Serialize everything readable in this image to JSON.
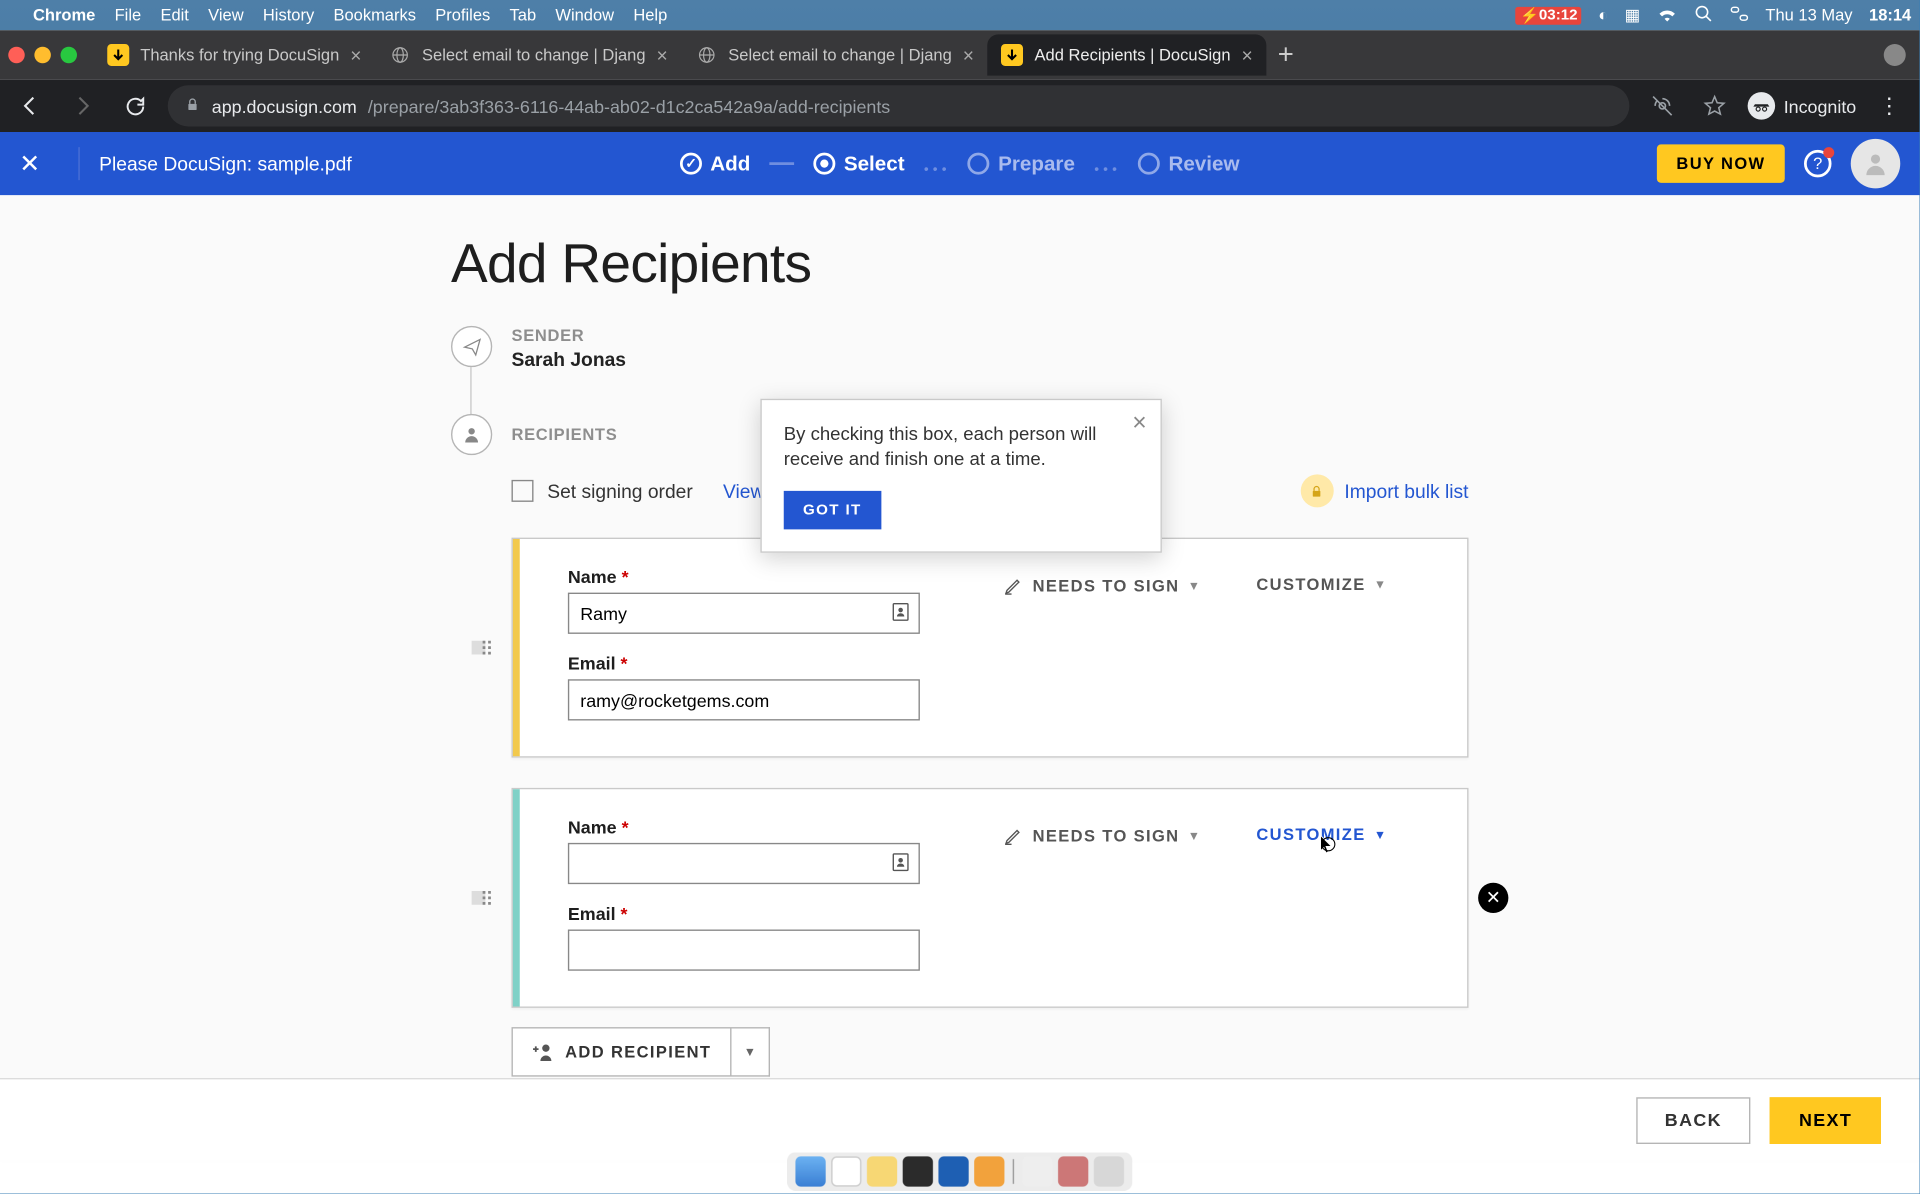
{
  "menubar": {
    "app": "Chrome",
    "items": [
      "File",
      "Edit",
      "View",
      "History",
      "Bookmarks",
      "Profiles",
      "Tab",
      "Window",
      "Help"
    ],
    "battery": "03:12",
    "date": "Thu 13 May",
    "time": "18:14"
  },
  "tabs": [
    {
      "title": "Thanks for trying DocuSign",
      "active": false,
      "fav": "ds"
    },
    {
      "title": "Select email to change | Djang",
      "active": false,
      "fav": "globe"
    },
    {
      "title": "Select email to change | Djang",
      "active": false,
      "fav": "globe"
    },
    {
      "title": "Add Recipients | DocuSign",
      "active": true,
      "fav": "ds"
    }
  ],
  "url": {
    "host": "app.docusign.com",
    "path": "/prepare/3ab3f363-6116-44ab-ab02-d1c2ca542a9a/add-recipients"
  },
  "incognito": "Incognito",
  "dsbar": {
    "doc": "Please DocuSign: sample.pdf",
    "steps": {
      "add": "Add",
      "select": "Select",
      "prepare": "Prepare",
      "review": "Review"
    },
    "buy": "BUY NOW"
  },
  "page": {
    "title": "Add Recipients",
    "sender_label": "SENDER",
    "sender_name": "Sarah Jonas",
    "recipients_label": "RECIPIENTS",
    "set_order": "Set signing order",
    "view": "View",
    "import": "Import bulk list",
    "name_label": "Name",
    "email_label": "Email",
    "needs": "NEEDS TO SIGN",
    "customize": "CUSTOMIZE",
    "add_recipient": "ADD RECIPIENT",
    "back": "BACK",
    "next": "NEXT",
    "recipients": [
      {
        "name": "Ramy",
        "email": "ramy@rocketgems.com",
        "color": "yellow"
      },
      {
        "name": "",
        "email": "",
        "color": "teal"
      }
    ]
  },
  "popover": {
    "text": "By checking this box, each person will receive and finish one at a time.",
    "got": "GOT IT"
  }
}
